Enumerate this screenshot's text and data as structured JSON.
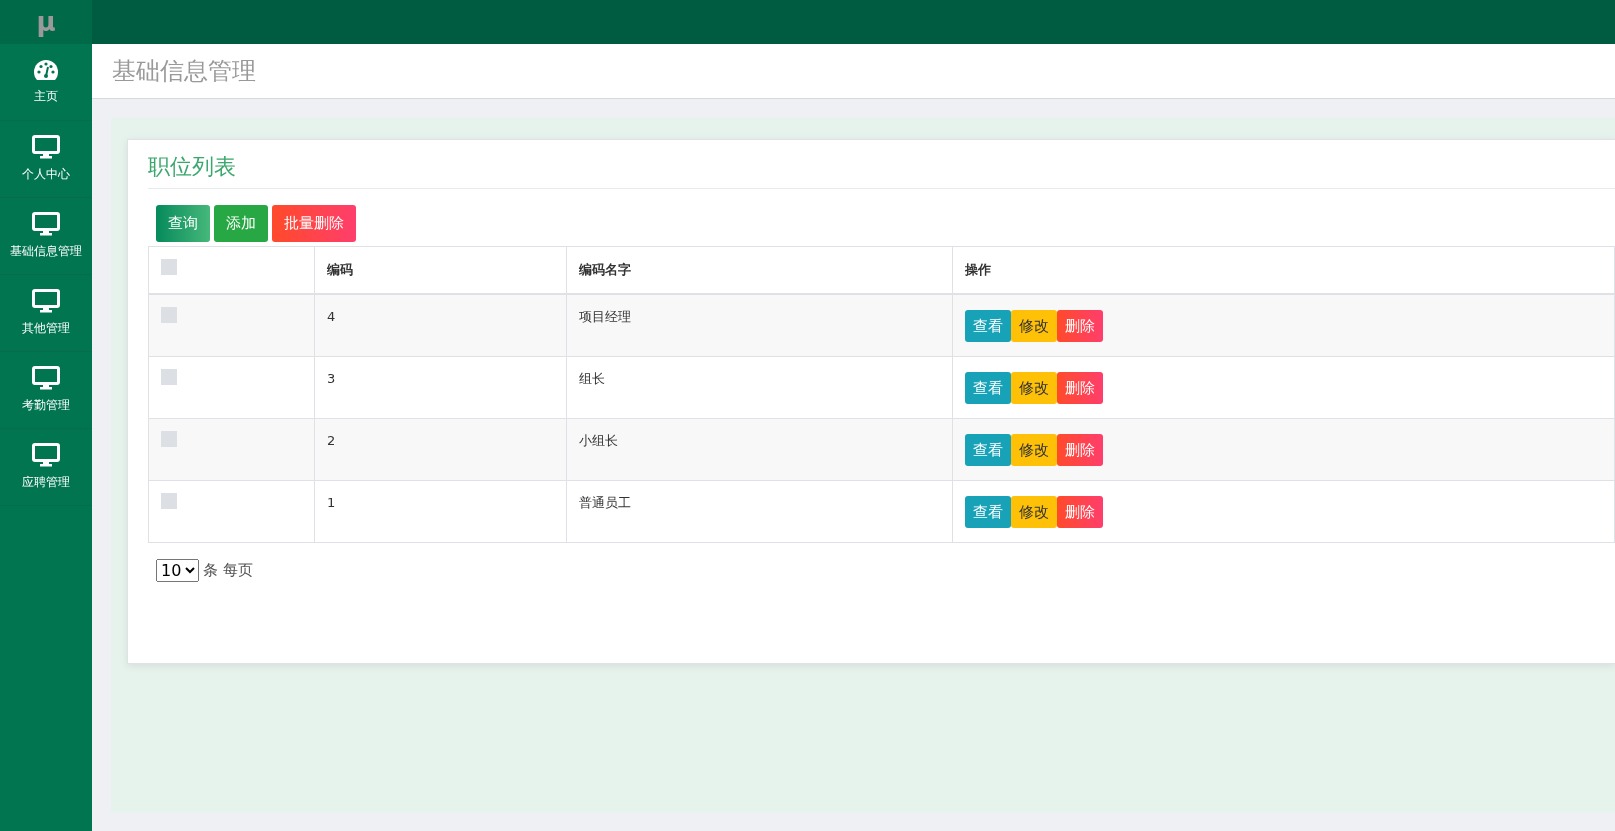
{
  "logo": "μ",
  "sidebar": {
    "items": [
      {
        "label": "主页",
        "kind": "dashboard",
        "selected": false
      },
      {
        "label": "个人中心",
        "kind": "monitor",
        "selected": false
      },
      {
        "label": "基础信息管理",
        "kind": "monitor",
        "selected": false
      },
      {
        "label": "其他管理",
        "kind": "monitor",
        "selected": false
      },
      {
        "label": "考勤管理",
        "kind": "monitor",
        "selected": false
      },
      {
        "label": "应聘管理",
        "kind": "monitor",
        "selected": false
      }
    ]
  },
  "page_title": "基础信息管理",
  "panel": {
    "title": "职位列表",
    "toolbar": [
      {
        "label": "查询",
        "kind": "search"
      },
      {
        "label": "添加",
        "kind": "add"
      },
      {
        "label": "批量删除",
        "kind": "delete"
      }
    ],
    "table": {
      "header_checked": false,
      "columns": [
        "编码",
        "编码名字",
        "操作"
      ],
      "rows": [
        {
          "checked": false,
          "code": "4",
          "name": "项目经理",
          "actions": [
            {
              "label": "查看",
              "kind": "view"
            },
            {
              "label": "修改",
              "kind": "edit"
            },
            {
              "label": "删除",
              "kind": "delete"
            }
          ]
        },
        {
          "checked": false,
          "code": "3",
          "name": "组长",
          "actions": [
            {
              "label": "查看",
              "kind": "view"
            },
            {
              "label": "修改",
              "kind": "edit"
            },
            {
              "label": "删除",
              "kind": "delete"
            }
          ]
        },
        {
          "checked": false,
          "code": "2",
          "name": "小组长",
          "actions": [
            {
              "label": "查看",
              "kind": "view"
            },
            {
              "label": "修改",
              "kind": "edit"
            },
            {
              "label": "删除",
              "kind": "delete"
            }
          ]
        },
        {
          "checked": false,
          "code": "1",
          "name": "普通员工",
          "actions": [
            {
              "label": "查看",
              "kind": "view"
            },
            {
              "label": "修改",
              "kind": "edit"
            },
            {
              "label": "删除",
              "kind": "delete"
            }
          ]
        }
      ]
    },
    "page_size": {
      "value": "10",
      "label": "条 每页"
    }
  }
}
